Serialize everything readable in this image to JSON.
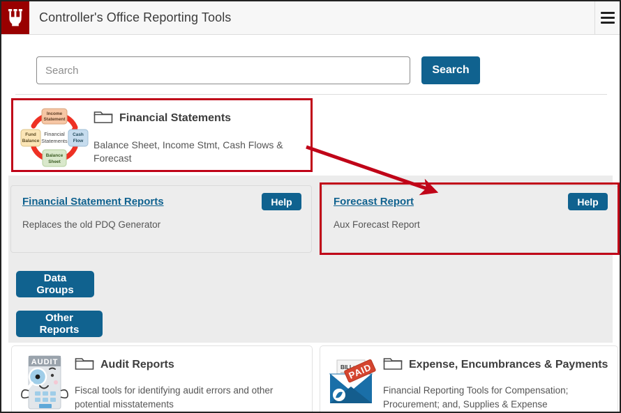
{
  "header": {
    "logo_name": "iu-trident-logo",
    "title": "Controller's Office Reporting Tools",
    "menu_icon": "hamburger-menu-icon"
  },
  "search": {
    "placeholder": "Search",
    "value": "",
    "button_label": "Search"
  },
  "financial_statements_card": {
    "icon_name": "financial-statements-cycle-icon",
    "folder_icon": "folder-icon",
    "title": "Financial Statements",
    "description": "Balance Sheet, Income Stmt, Cash Flows & Forecast",
    "cycle_labels": {
      "top": "Income Statement",
      "left": "Fund Balance",
      "right": "Cash Flow",
      "bottom": "Balance Sheet",
      "center": "Financial Statements"
    }
  },
  "report_cards": [
    {
      "link": "Financial Statement Reports",
      "description": "Replaces the old PDQ Generator",
      "help_label": "Help"
    },
    {
      "link": "Forecast Report",
      "description": "Aux Forecast Report",
      "help_label": "Help"
    }
  ],
  "action_buttons": [
    {
      "label": "Data Groups"
    },
    {
      "label": "Other Reports"
    }
  ],
  "bottom_cards": [
    {
      "icon_name": "audit-calculator-character-icon",
      "icon_banner": "AUDIT",
      "folder_icon": "folder-icon",
      "title": "Audit Reports",
      "description": "Fiscal tools for identifying audit errors and other potential misstatements"
    },
    {
      "icon_name": "paid-bill-envelope-icon",
      "icon_bill_label": "BILL: $",
      "icon_stamp_label": "PAID",
      "folder_icon": "folder-icon",
      "title": "Expense, Encumbrances & Payments",
      "description": "Financial Reporting Tools for Compensation; Procurement; and, Supplies & Expense"
    }
  ],
  "annotations": {
    "highlight_color": "#c00418",
    "box_1_target": "Financial Statements",
    "box_2_target": "Forecast Report",
    "arrow": "arrow-from-financial-statements-to-forecast-report"
  },
  "colors": {
    "brand_crimson": "#990000",
    "accent_blue": "#10628f",
    "panel_gray": "#ececec"
  }
}
